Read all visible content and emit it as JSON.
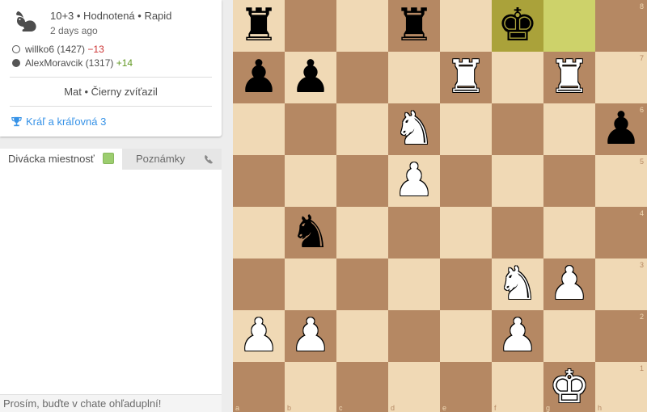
{
  "game": {
    "speed_icon": "rabbit-icon",
    "title": "10+3 • Hodnotená • Rapid",
    "date": "2 days ago",
    "white": {
      "name": "willko6 (1427)",
      "diff": "−13"
    },
    "black": {
      "name": "AlexMoravcik (1317)",
      "diff": "+14"
    },
    "result": "Mat • Čierny zvíťazil",
    "tournament": "Kráľ a kráľovná 3"
  },
  "chat": {
    "tab_chat": "Divácka miestnosť",
    "tab_notes": "Poznámky",
    "placeholder": "Prosím, buďte v chate ohľaduplní!"
  },
  "board": {
    "files": [
      "a",
      "b",
      "c",
      "d",
      "e",
      "f",
      "g",
      "h"
    ],
    "ranks": [
      "8",
      "7",
      "6",
      "5",
      "4",
      "3",
      "2",
      "1"
    ],
    "highlight_from": "g8",
    "highlight_to": "f8",
    "colors": {
      "light": "#f0d9b5",
      "dark": "#b58863",
      "move_from": "#cdd26a",
      "move_to": "#aaa23a"
    },
    "pieces": [
      {
        "square": "a8",
        "color": "black",
        "type": "rook"
      },
      {
        "square": "d8",
        "color": "black",
        "type": "rook"
      },
      {
        "square": "f8",
        "color": "black",
        "type": "king"
      },
      {
        "square": "a7",
        "color": "black",
        "type": "pawn"
      },
      {
        "square": "b7",
        "color": "black",
        "type": "pawn"
      },
      {
        "square": "e7",
        "color": "white",
        "type": "rook"
      },
      {
        "square": "g7",
        "color": "white",
        "type": "rook"
      },
      {
        "square": "d6",
        "color": "white",
        "type": "knight"
      },
      {
        "square": "h6",
        "color": "black",
        "type": "pawn"
      },
      {
        "square": "d5",
        "color": "white",
        "type": "pawn"
      },
      {
        "square": "b4",
        "color": "black",
        "type": "knight"
      },
      {
        "square": "f3",
        "color": "white",
        "type": "knight"
      },
      {
        "square": "g3",
        "color": "white",
        "type": "pawn"
      },
      {
        "square": "a2",
        "color": "white",
        "type": "pawn"
      },
      {
        "square": "b2",
        "color": "white",
        "type": "pawn"
      },
      {
        "square": "f2",
        "color": "white",
        "type": "pawn"
      },
      {
        "square": "g1",
        "color": "white",
        "type": "king"
      }
    ]
  }
}
